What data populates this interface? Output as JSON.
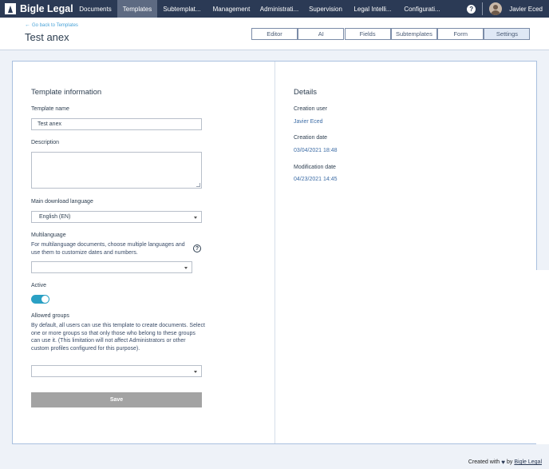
{
  "brand": {
    "name": "Bigle Legal",
    "icon": "bigle-logo-icon"
  },
  "nav": {
    "items": [
      {
        "label": "Documents",
        "active": false
      },
      {
        "label": "Templates",
        "active": true
      },
      {
        "label": "Subtemplat...",
        "active": false
      },
      {
        "label": "Management",
        "active": false
      },
      {
        "label": "Administrati...",
        "active": false
      },
      {
        "label": "Supervision",
        "active": false
      },
      {
        "label": "Legal Intelli...",
        "active": false
      },
      {
        "label": "Configurati...",
        "active": false
      }
    ],
    "help": "?",
    "user_name": "Javier Eced"
  },
  "header": {
    "back_link": "Go back to Templates",
    "back_icon": "←",
    "title": "Test anex",
    "tabs": [
      {
        "label": "Editor",
        "active": false
      },
      {
        "label": "AI",
        "active": false
      },
      {
        "label": "Fields",
        "active": false
      },
      {
        "label": "Subtemplates",
        "active": false
      },
      {
        "label": "Form",
        "active": false
      },
      {
        "label": "Settings",
        "active": true
      }
    ]
  },
  "template_info": {
    "title": "Template information",
    "name_label": "Template name",
    "name_value": "Test anex",
    "description_label": "Description",
    "description_value": "",
    "language_label": "Main download language",
    "language_value": "English (EN)",
    "multilanguage_label": "Multilanguage",
    "multilanguage_help": "For multilanguage documents, choose multiple languages and use them to customize dates and numbers.",
    "multilanguage_value": "",
    "help_icon_text": "?",
    "active_label": "Active",
    "active": true,
    "groups_label": "Allowed groups",
    "groups_help": "By default, all users can use this template to create documents. Select one or more groups so that only those who belong to these groups can use it. (This limitation will not affect Administrators or other custom profiles configured for this purpose).",
    "groups_value": "",
    "save_label": "Save"
  },
  "details": {
    "title": "Details",
    "creation_user_label": "Creation user",
    "creation_user_value": "Javier Eced",
    "creation_date_label": "Creation date",
    "creation_date_value": "03/04/2021 18:48",
    "modification_date_label": "Modification date",
    "modification_date_value": "04/23/2021 14:45"
  },
  "footer": {
    "prefix": "Created with",
    "heart": "♥",
    "by": "by",
    "link": "Bigle Legal"
  },
  "colors": {
    "nav_bg": "#2b3a55",
    "nav_active": "#5d6a82",
    "accent": "#2aa0c4",
    "link": "#4aa3d8",
    "save_disabled": "#a3a3a3"
  }
}
